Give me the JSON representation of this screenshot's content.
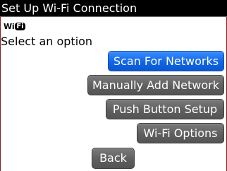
{
  "window": {
    "title": "Set Up Wi-Fi Connection"
  },
  "logo": {
    "text_left": "Wi",
    "text_right": "Fi"
  },
  "prompt": {
    "text": "Select an option"
  },
  "buttons": {
    "scan": "Scan For Networks",
    "manual": "Manually Add Network",
    "push": "Push Button Setup",
    "options": "Wi-Fi Options",
    "back": "Back"
  },
  "colors": {
    "title_bar": "#000000",
    "button_default": "#5f5f5f",
    "button_focused": "#1066e6",
    "background": "#ffffff"
  }
}
